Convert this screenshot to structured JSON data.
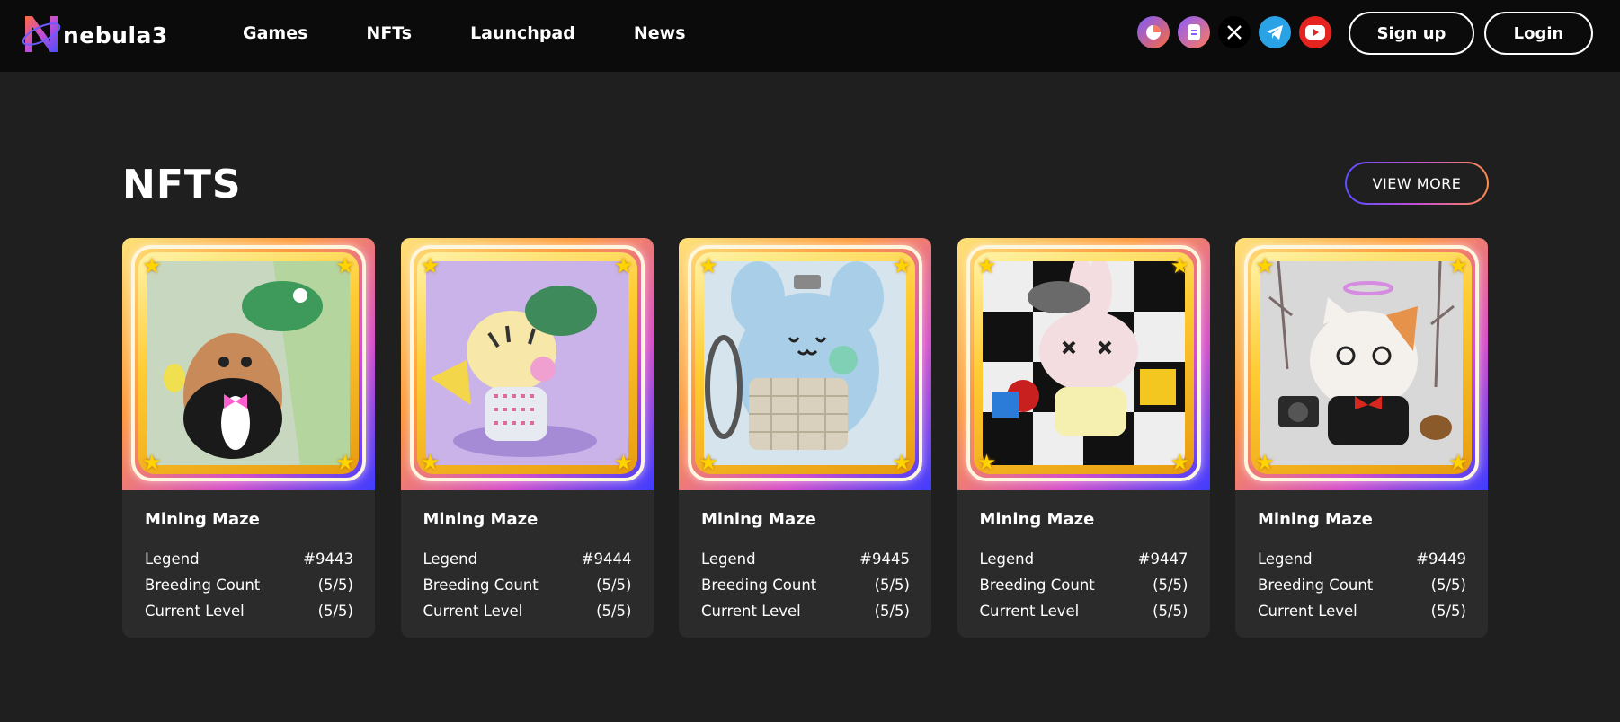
{
  "brand": {
    "name": "nebula3"
  },
  "nav": [
    {
      "label": "Games"
    },
    {
      "label": "NFTs"
    },
    {
      "label": "Launchpad"
    },
    {
      "label": "News"
    }
  ],
  "socials": [
    "chart-icon",
    "mirror-icon",
    "x-icon",
    "telegram-icon",
    "youtube-icon"
  ],
  "auth": {
    "signup": "Sign up",
    "login": "Login"
  },
  "section": {
    "title": "NFTS",
    "view_more": "VIEW MORE"
  },
  "labels": {
    "legend": "Legend",
    "breeding": "Breeding Count",
    "level": "Current Level"
  },
  "cards": [
    {
      "title": "Mining Maze",
      "id": "#9443",
      "breeding": "(5/5)",
      "level": "(5/5)",
      "art": "hamster-with-frog-hat"
    },
    {
      "title": "Mining Maze",
      "id": "#9444",
      "breeding": "(5/5)",
      "level": "(5/5)",
      "art": "tiger-with-frog-hat"
    },
    {
      "title": "Mining Maze",
      "id": "#9445",
      "breeding": "(5/5)",
      "level": "(5/5)",
      "art": "blue-mouse-with-lollipop"
    },
    {
      "title": "Mining Maze",
      "id": "#9447",
      "breeding": "(5/5)",
      "level": "(5/5)",
      "art": "bunny-with-cap"
    },
    {
      "title": "Mining Maze",
      "id": "#9449",
      "breeding": "(5/5)",
      "level": "(5/5)",
      "art": "calico-cat-with-camera"
    }
  ],
  "colors": {
    "background": "#1f1f1f",
    "header": "#0b0b0b",
    "card": "#2b2b2b",
    "accent_gradient": [
      "#5a4dff",
      "#c44fd6",
      "#ff8a4c"
    ],
    "gold": "#ffcc33"
  }
}
